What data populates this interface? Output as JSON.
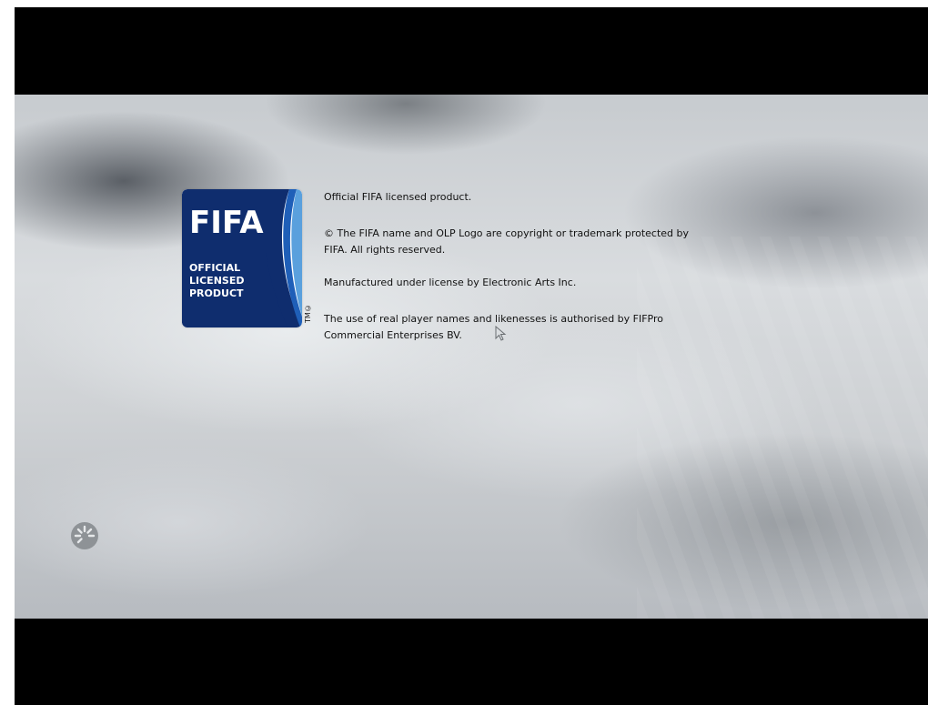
{
  "logo": {
    "brand": "FIFA",
    "line1": "OFFICIAL",
    "line2": "LICENSED",
    "line3": "PRODUCT",
    "tm": "TM©",
    "colors": {
      "navy": "#0f2d6e",
      "blue": "#1f5fb8",
      "light_blue": "#5aa0dd"
    }
  },
  "legal": {
    "line1": "Official FIFA licensed product.",
    "line2a": "© The FIFA name and OLP Logo are copyright or trademark protected by",
    "line2b": "FIFA. All rights reserved.",
    "line3": "Manufactured under license by Electronic Arts Inc.",
    "line4a": "The use of real player names and likenesses is authorised by FIFPro",
    "line4b": "Commercial Enterprises BV."
  },
  "loading": {
    "icon": "loading-spinner-icon"
  },
  "pointer": {
    "icon": "mouse-cursor-icon"
  }
}
